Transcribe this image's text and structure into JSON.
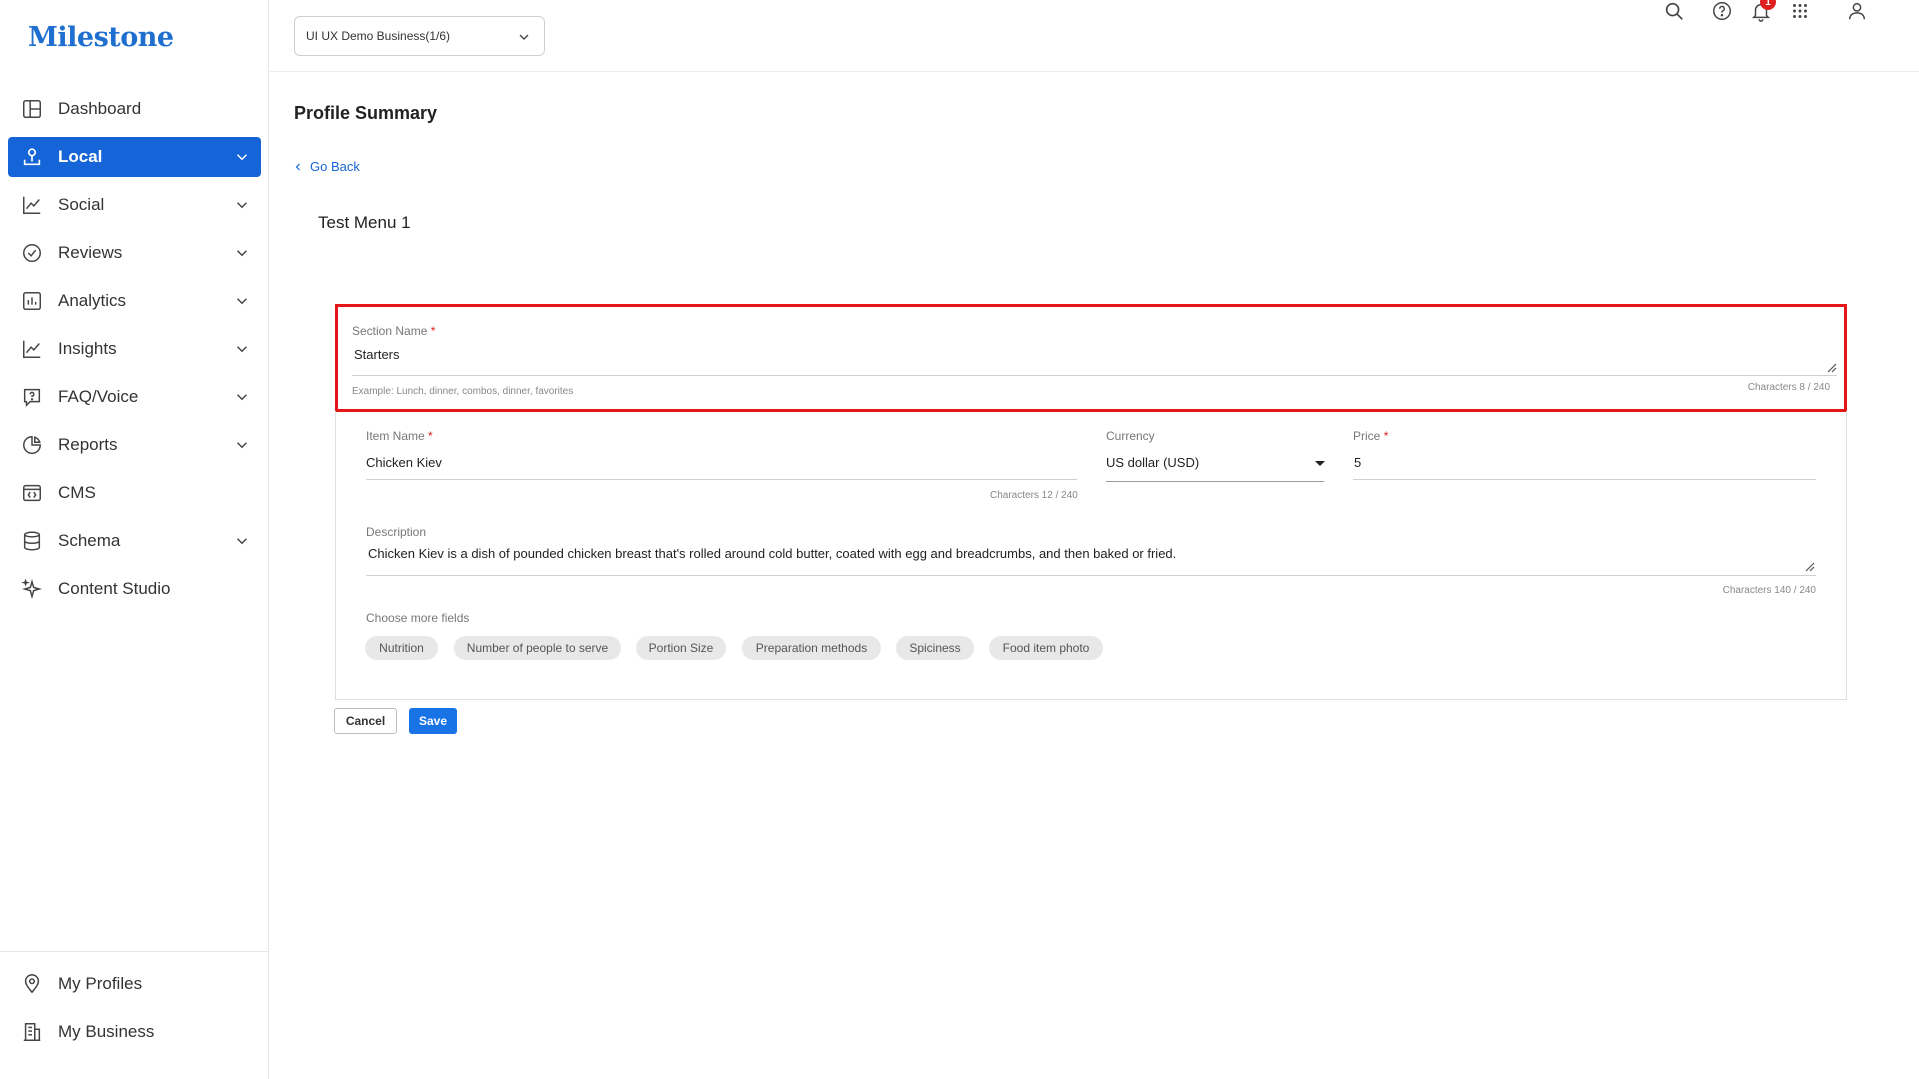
{
  "app": {
    "logo_text": "Milestone",
    "brand_color": "#1565d8",
    "highlight_color": "#e41616"
  },
  "sidebar": {
    "items": [
      {
        "label": "Dashboard",
        "icon": "dashboard-icon",
        "has_chevron": false,
        "active": false
      },
      {
        "label": "Local",
        "icon": "local-pin-icon",
        "has_chevron": true,
        "active": true
      },
      {
        "label": "Social",
        "icon": "line-chart-icon",
        "has_chevron": true,
        "active": false
      },
      {
        "label": "Reviews",
        "icon": "check-circle-icon",
        "has_chevron": true,
        "active": false
      },
      {
        "label": "Analytics",
        "icon": "bar-chart-icon",
        "has_chevron": true,
        "active": false
      },
      {
        "label": "Insights",
        "icon": "line-chart-icon",
        "has_chevron": true,
        "active": false
      },
      {
        "label": "FAQ/Voice",
        "icon": "faq-icon",
        "has_chevron": true,
        "active": false
      },
      {
        "label": "Reports",
        "icon": "pie-chart-icon",
        "has_chevron": true,
        "active": false
      },
      {
        "label": "CMS",
        "icon": "cms-icon",
        "has_chevron": false,
        "active": false
      },
      {
        "label": "Schema",
        "icon": "database-icon",
        "has_chevron": true,
        "active": false
      },
      {
        "label": "Content Studio",
        "icon": "sparkle-icon",
        "has_chevron": false,
        "active": false
      }
    ],
    "bottom_items": [
      {
        "label": "My Profiles",
        "icon": "location-pin-icon"
      },
      {
        "label": "My Business",
        "icon": "building-icon"
      }
    ]
  },
  "topbar": {
    "business_select": "UI UX Demo Business(1/6)",
    "notification_count": "1",
    "icons": [
      "search-icon",
      "help-icon",
      "bell-icon",
      "apps-grid-icon",
      "user-icon"
    ]
  },
  "page": {
    "title": "Profile Summary",
    "go_back": "Go Back",
    "menu_title": "Test Menu 1"
  },
  "section": {
    "label": "Section Name",
    "required_mark": "*",
    "value": "Starters",
    "hint": "Example: Lunch, dinner, combos, dinner, favorites",
    "char_count": "Characters 8 / 240"
  },
  "item": {
    "name_label": "Item Name",
    "name_value": "Chicken Kiev",
    "name_char_count": "Characters 12 / 240",
    "currency_label": "Currency",
    "currency_value": "US dollar (USD)",
    "price_label": "Price",
    "price_value": "5",
    "description_label": "Description",
    "description_value": "Chicken Kiev is a dish of pounded chicken breast that's rolled around cold butter, coated with egg and breadcrumbs, and then baked or fried.",
    "description_char_count": "Characters 140 / 240",
    "more_fields_label": "Choose more fields",
    "chips": [
      "Nutrition",
      "Number of people to serve",
      "Portion Size",
      "Preparation methods",
      "Spiciness",
      "Food item photo"
    ]
  },
  "actions": {
    "cancel": "Cancel",
    "save": "Save"
  }
}
